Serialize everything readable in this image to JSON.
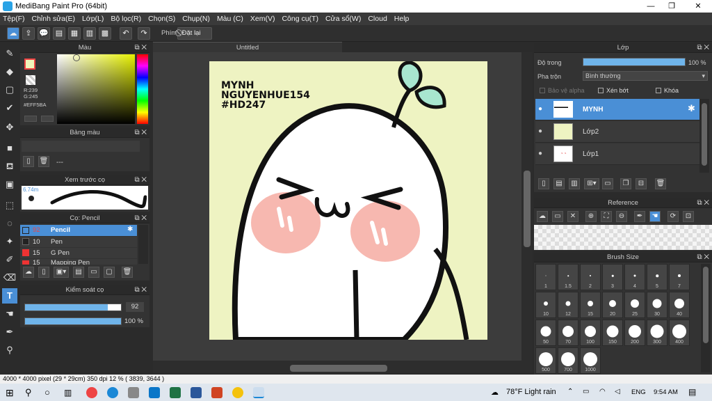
{
  "window": {
    "title": "MediBang Paint Pro (64bit)"
  },
  "menu": [
    "Tệp(F)",
    "Chỉnh sửa(E)",
    "Lớp(L)",
    "Bộ lọc(R)",
    "Chọn(S)",
    "Chụp(N)",
    "Màu (C)",
    "Xem(V)",
    "Công cụ(T)",
    "Cửa sổ(W)",
    "Cloud",
    "Help"
  ],
  "toolbar": {
    "hotkey_label": "Phím",
    "reset_label": "Đặt lại"
  },
  "color_panel": {
    "title": "Màu",
    "r": "R:239",
    "g": "G:245",
    "hex": "#EFF5BA"
  },
  "palette_panel": {
    "title": "Bảng màu",
    "value": "---"
  },
  "brush_preview": {
    "title": "Xem trước cọ",
    "size": "6.74m"
  },
  "brush_panel": {
    "title": "Cọ: Pencil",
    "items": [
      {
        "size": "92",
        "name": "Pencil"
      },
      {
        "size": "10",
        "name": "Pen"
      },
      {
        "size": "15",
        "name": "G Pen"
      },
      {
        "size": "15",
        "name": "Mapping Pen"
      }
    ]
  },
  "brush_control": {
    "title": "Kiểm soát cọ",
    "size": "92",
    "opacity": "100 %"
  },
  "canvas": {
    "tab": "Untitled",
    "text_line1": "MYNH",
    "text_line2": "NGUYENHUE154",
    "text_line3": "#HD247"
  },
  "layer_panel": {
    "title": "Lớp",
    "opacity_label": "Độ trong",
    "opacity_value": "100 %",
    "blend_label": "Pha trộn",
    "blend_value": "Bình thường",
    "protect_alpha": "Bảo vệ alpha",
    "clip": "Xén bớt",
    "lock": "Khóa",
    "layers": [
      "MYNH",
      "Lớp2",
      "Lớp1"
    ]
  },
  "reference_panel": {
    "title": "Reference"
  },
  "brush_size_panel": {
    "title": "Brush Size",
    "sizes": [
      "1",
      "1.5",
      "2",
      "3",
      "4",
      "5",
      "7",
      "10",
      "12",
      "15",
      "20",
      "25",
      "30",
      "40",
      "50",
      "70",
      "100",
      "150",
      "200",
      "300",
      "400",
      "500",
      "700",
      "1000"
    ]
  },
  "status": {
    "text": "4000 * 4000 pixel   (29 * 29cm)   350 dpi   12 %   ( 3839, 3644 )"
  },
  "taskbar": {
    "weather": "78°F  Light rain",
    "lang": "ENG",
    "time": "9:54 AM"
  },
  "colors": {
    "accent": "#4a8fd6",
    "canvas_bg": "#eef3c2",
    "leaf": "#a8e6cf",
    "blush": "#f7b8b0"
  }
}
